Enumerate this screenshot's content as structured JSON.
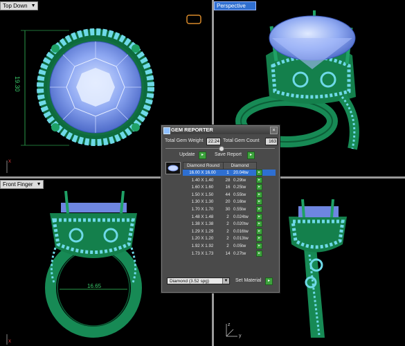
{
  "viewports": {
    "top": {
      "label": "Top Down"
    },
    "perspective": {
      "label": "Perspective"
    },
    "front": {
      "label": "Front Finger"
    },
    "side": {
      "label": ""
    }
  },
  "dimensions": {
    "stone_height": "19.30",
    "ring_width": "16.65"
  },
  "colors": {
    "metal": "#1e9e62",
    "metal_dark": "#0c5e37",
    "gem": "#7f9cf0",
    "gem_light": "#c7d8ff",
    "pave": "#6ed9e8",
    "active_label": "#2f6fd0"
  },
  "gem_reporter": {
    "title": "GEM REPORTER",
    "total_weight_label": "Total Gem Weight",
    "total_weight_value": "22.24",
    "total_count_label": "Total Gem Count",
    "total_count_value": "163",
    "update_label": "Update",
    "save_report_label": "Save Report",
    "col_shape": "Diamond Round",
    "col_type": "Diamond",
    "rows": [
      {
        "size": "16.00 X 16.00",
        "count": "1",
        "weight": "20.04tw"
      },
      {
        "size": "1.40 X 1.40",
        "count": "28",
        "weight": "0.29tw"
      },
      {
        "size": "1.60 X 1.60",
        "count": "16",
        "weight": "0.25tw"
      },
      {
        "size": "1.50 X 1.50",
        "count": "44",
        "weight": "0.55tw"
      },
      {
        "size": "1.30 X 1.30",
        "count": "20",
        "weight": "0.16tw"
      },
      {
        "size": "1.70 X 1.70",
        "count": "30",
        "weight": "0.55tw"
      },
      {
        "size": "1.48 X 1.48",
        "count": "2",
        "weight": "0.024tw"
      },
      {
        "size": "1.38 X 1.38",
        "count": "2",
        "weight": "0.020tw"
      },
      {
        "size": "1.29 X 1.29",
        "count": "2",
        "weight": "0.016tw"
      },
      {
        "size": "1.20 X 1.20",
        "count": "2",
        "weight": "0.013tw"
      },
      {
        "size": "1.92 X 1.92",
        "count": "2",
        "weight": "0.05tw"
      },
      {
        "size": "1.73 X 1.73",
        "count": "14",
        "weight": "0.27tw"
      }
    ],
    "material_value": "Diamond   (3.52 spg)",
    "set_material_label": "Set Material"
  },
  "icons": {
    "go": "▸",
    "close": "×",
    "dropdown": "▼"
  }
}
